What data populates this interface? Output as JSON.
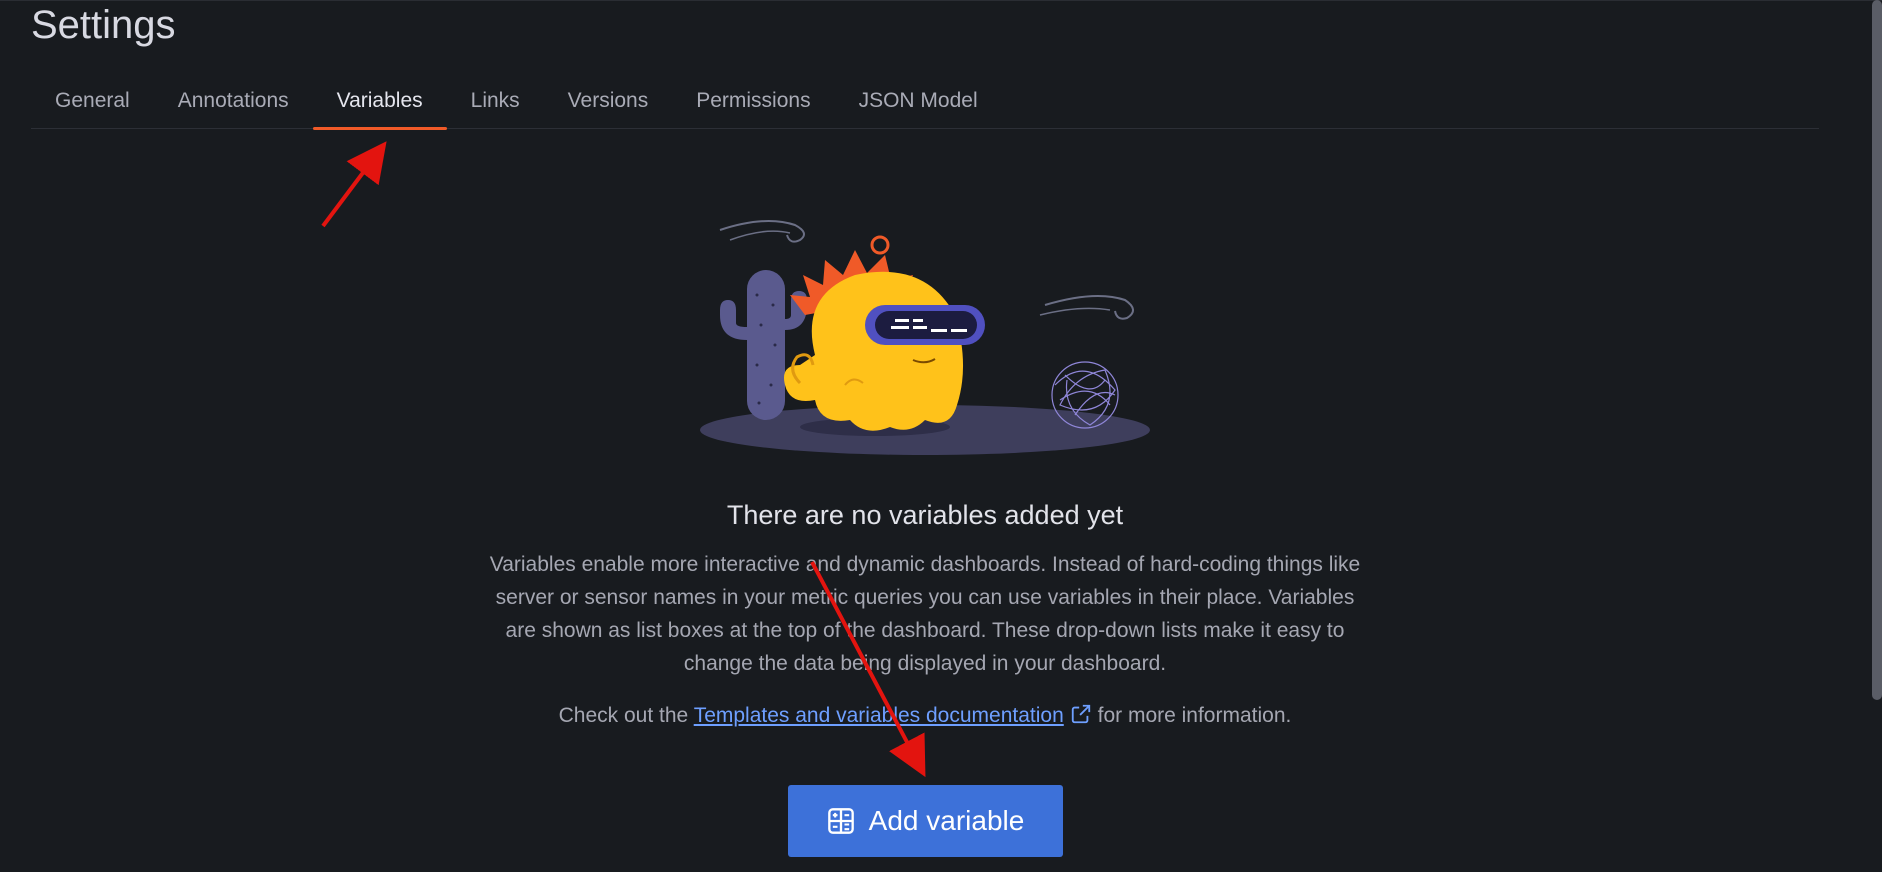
{
  "page": {
    "title": "Settings"
  },
  "tabs": [
    {
      "label": "General",
      "active": false
    },
    {
      "label": "Annotations",
      "active": false
    },
    {
      "label": "Variables",
      "active": true
    },
    {
      "label": "Links",
      "active": false
    },
    {
      "label": "Versions",
      "active": false
    },
    {
      "label": "Permissions",
      "active": false
    },
    {
      "label": "JSON Model",
      "active": false
    }
  ],
  "empty_state": {
    "title": "There are no variables added yet",
    "description": "Variables enable more interactive and dynamic dashboards. Instead of hard-coding things like server or sensor names in your metric queries you can use variables in their place. Variables are shown as list boxes at the top of the dashboard. These drop-down lists make it easy to change the data being displayed in your dashboard.",
    "cta_prefix": "Check out the",
    "doc_link": "Templates and variables documentation",
    "cta_suffix": "for more information.",
    "add_button": "Add variable",
    "illustration_icon": "grafana-mascot-desert"
  },
  "colors": {
    "background": "#181b1f",
    "active_tab_underline": "#f05a28",
    "primary_button": "#3d71d9",
    "link": "#6e9fff",
    "annotation_arrow": "#e3140f"
  }
}
